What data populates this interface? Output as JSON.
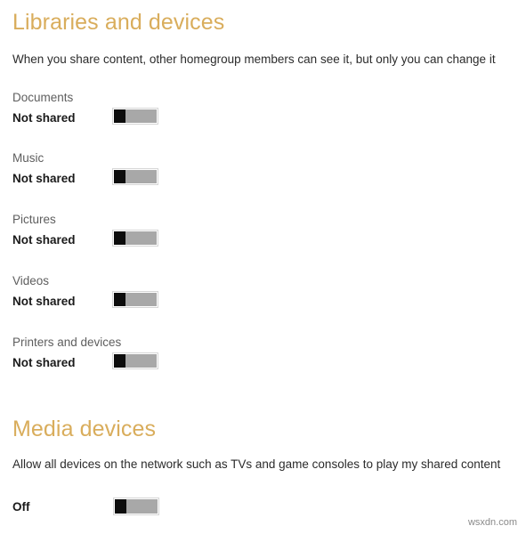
{
  "theme": {
    "background": "#ffffff",
    "heading_color": "#d9ad5c",
    "body_text_color": "#2b2b2b",
    "setting_title_color": "#5e5e5e",
    "setting_state_color": "#1a1a1a",
    "toggle_track_color": "#a8a8a8",
    "toggle_thumb_color": "#0d0d0d",
    "toggle_border_color": "#d6d6d6",
    "watermark_color": "#8a8a8a"
  },
  "libraries_section": {
    "heading": "Libraries and devices",
    "description": "When you share content, other homegroup members can see it, but only you can change it",
    "rows": [
      {
        "title": "Documents",
        "state": "Not shared",
        "toggle_on": false,
        "toggle_name": "documents-toggle"
      },
      {
        "title": "Music",
        "state": "Not shared",
        "toggle_on": false,
        "toggle_name": "music-toggle"
      },
      {
        "title": "Pictures",
        "state": "Not shared",
        "toggle_on": false,
        "toggle_name": "pictures-toggle"
      },
      {
        "title": "Videos",
        "state": "Not shared",
        "toggle_on": false,
        "toggle_name": "videos-toggle"
      },
      {
        "title": "Printers and devices",
        "state": "Not shared",
        "toggle_on": false,
        "toggle_name": "printers-and-devices-toggle"
      }
    ]
  },
  "media_section": {
    "heading": "Media devices",
    "description": "Allow all devices on the network such as TVs and game consoles to play my shared content",
    "state": "Off",
    "toggle_on": false
  },
  "watermark": {
    "text": "wsxdn.com"
  }
}
